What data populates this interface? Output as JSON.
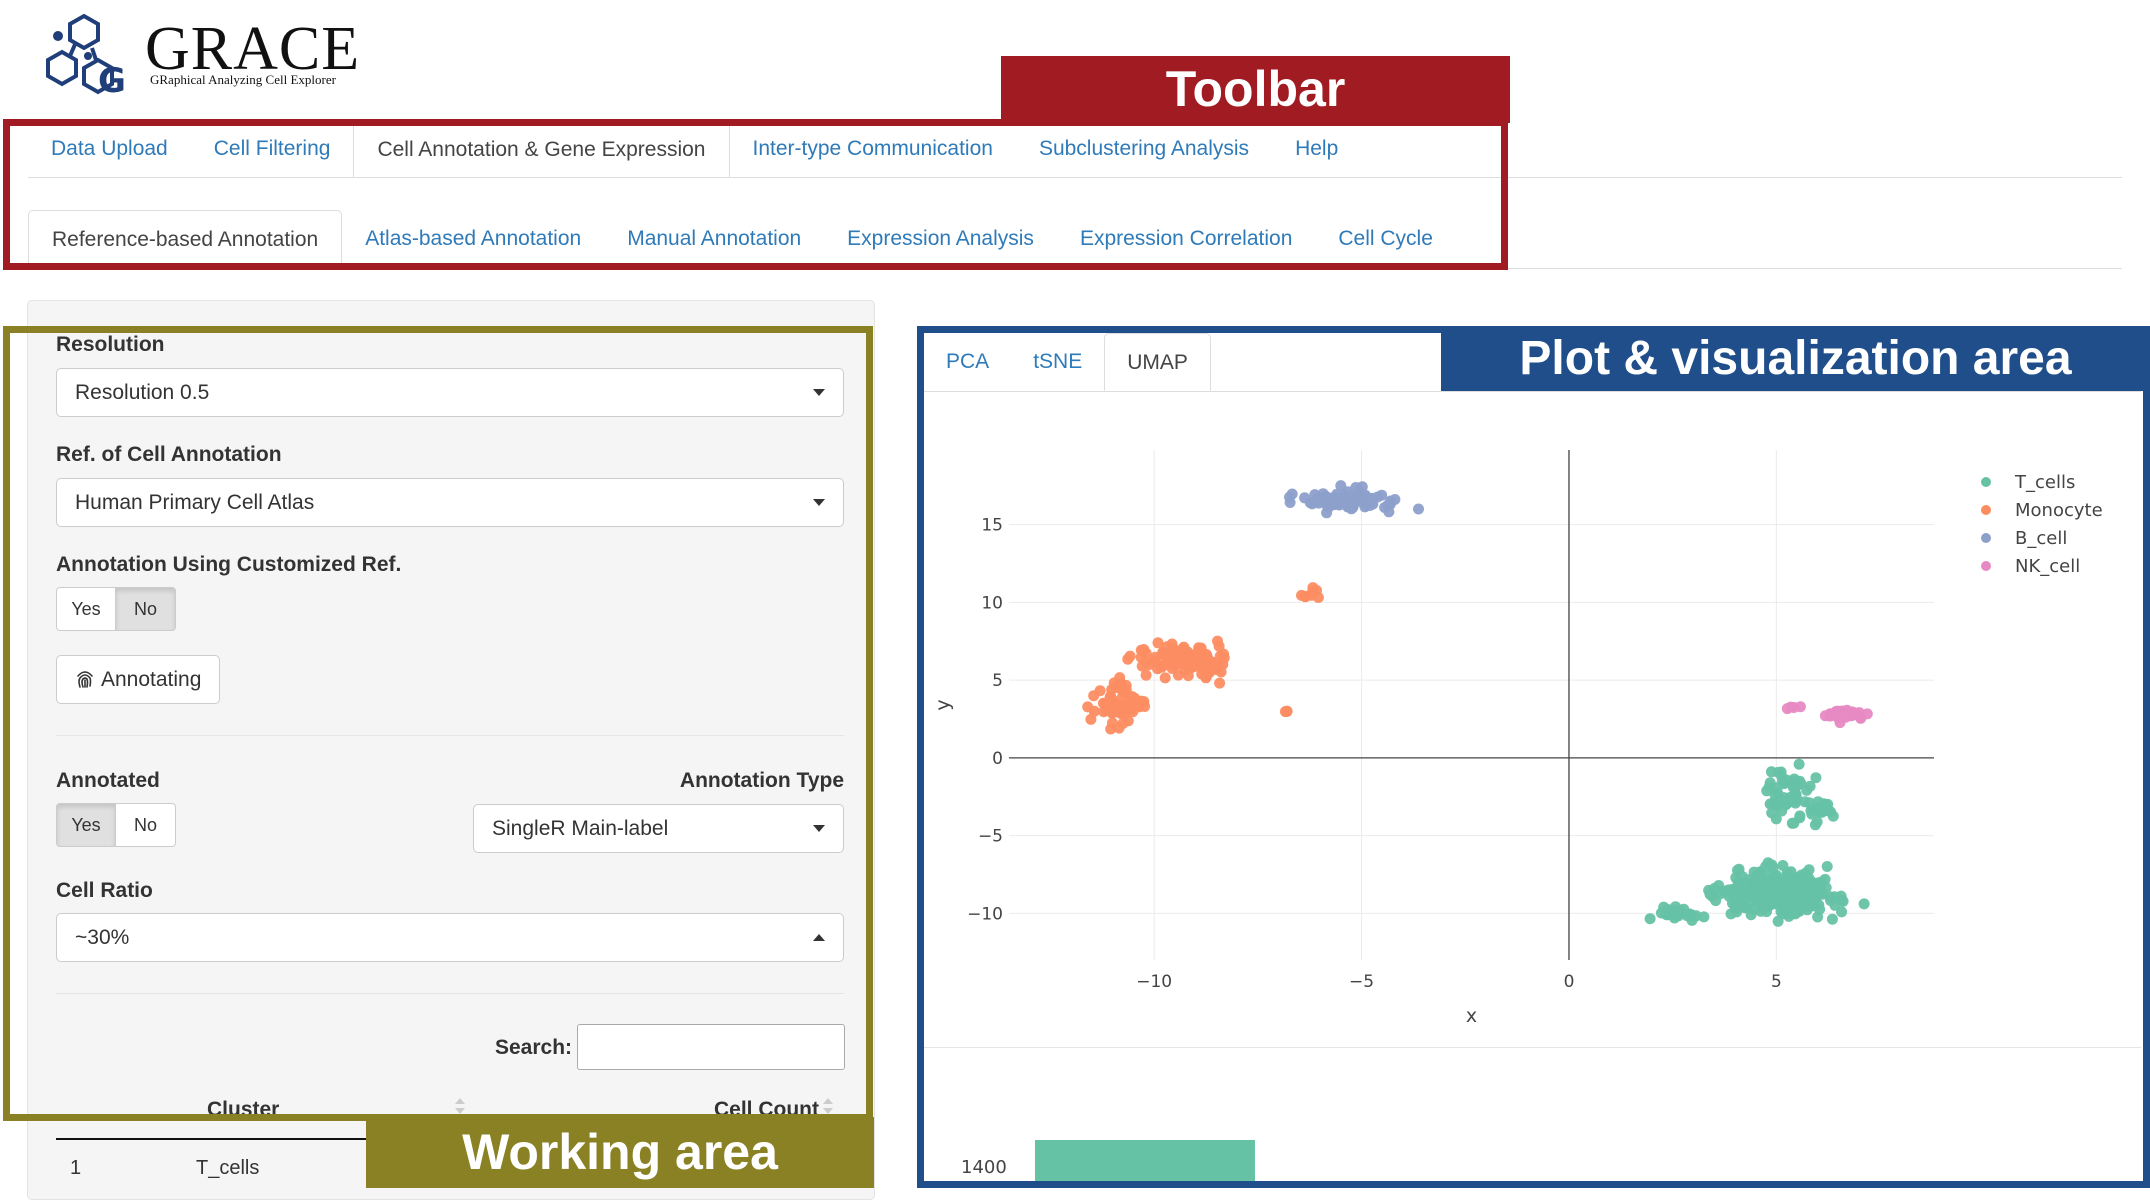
{
  "logo": {
    "title": "GRACE",
    "subtitle": "GRaphical Analyzing Cell Explorer"
  },
  "annotations": {
    "toolbar": "Toolbar",
    "working": "Working area",
    "plot": "Plot & visualization area"
  },
  "colors": {
    "toolbar": "#a01c22",
    "working": "#8a8124",
    "plot": "#1f4e8a",
    "link": "#2f7ab8"
  },
  "main_tabs": [
    {
      "label": "Data Upload",
      "active": false
    },
    {
      "label": "Cell Filtering",
      "active": false
    },
    {
      "label": "Cell Annotation & Gene Expression",
      "active": true
    },
    {
      "label": "Inter-type Communication",
      "active": false
    },
    {
      "label": "Subclustering Analysis",
      "active": false
    },
    {
      "label": "Help",
      "active": false
    }
  ],
  "sub_tabs": [
    {
      "label": "Reference-based Annotation",
      "active": true
    },
    {
      "label": "Atlas-based Annotation",
      "active": false
    },
    {
      "label": "Manual Annotation",
      "active": false
    },
    {
      "label": "Expression Analysis",
      "active": false
    },
    {
      "label": "Expression Correlation",
      "active": false
    },
    {
      "label": "Cell Cycle",
      "active": false
    }
  ],
  "working": {
    "resolution_label": "Resolution",
    "resolution_value": "Resolution 0.5",
    "ref_label": "Ref. of Cell Annotation",
    "ref_value": "Human Primary Cell Atlas",
    "custom_label": "Annotation Using Customized Ref.",
    "custom_yes": "Yes",
    "custom_no": "No",
    "custom_selected": "No",
    "annotate_button": "Annotating",
    "annotate_icon": "fingerprint-icon",
    "annotated_label": "Annotated",
    "annotated_yes": "Yes",
    "annotated_no": "No",
    "annotated_selected": "Yes",
    "annotation_type_label": "Annotation Type",
    "annotation_type_value": "SingleR Main-label",
    "ratio_label": "Cell Ratio",
    "ratio_value": "~30%",
    "search_label": "Search:",
    "search_value": "",
    "table": {
      "headers": [
        "Cluster",
        "Cell Count"
      ],
      "rows": [
        {
          "index": "1",
          "cluster": "T_cells"
        }
      ]
    }
  },
  "plot_tabs": [
    {
      "label": "PCA",
      "active": false
    },
    {
      "label": "tSNE",
      "active": false
    },
    {
      "label": "UMAP",
      "active": true
    }
  ],
  "chart_data": {
    "type": "scatter",
    "xlabel": "x",
    "ylabel": "y",
    "xlim": [
      -13.5,
      8.8
    ],
    "ylim": [
      -13,
      19.8
    ],
    "xticks": [
      -10,
      -5,
      0,
      5
    ],
    "xtick_labels": [
      "−10",
      "−5",
      "0",
      "5"
    ],
    "yticks": [
      -10,
      -5,
      0,
      5,
      10,
      15
    ],
    "ytick_labels": [
      "−10",
      "−5",
      "0",
      "5",
      "10",
      "15"
    ],
    "legend_position": "top-right",
    "series": [
      {
        "name": "T_cells",
        "color": "#66c2a5",
        "clusters": [
          {
            "cx": 5.0,
            "cy": -8.7,
            "sx": 1.3,
            "sy": 1.2,
            "n": 280
          },
          {
            "cx": 2.5,
            "cy": -10.0,
            "sx": 0.5,
            "sy": 0.3,
            "n": 25
          },
          {
            "cx": 5.4,
            "cy": -2.3,
            "sx": 0.5,
            "sy": 1.5,
            "n": 60
          },
          {
            "cx": 6.1,
            "cy": -3.2,
            "sx": 0.3,
            "sy": 0.4,
            "n": 15
          }
        ]
      },
      {
        "name": "Monocyte",
        "color": "#fc8d62",
        "clusters": [
          {
            "cx": -9.3,
            "cy": 6.3,
            "sx": 1.0,
            "sy": 0.8,
            "n": 120
          },
          {
            "cx": -10.8,
            "cy": 3.5,
            "sx": 0.5,
            "sy": 1.2,
            "n": 60
          },
          {
            "cx": -6.1,
            "cy": 10.6,
            "sx": 0.3,
            "sy": 0.3,
            "n": 8
          },
          {
            "cx": -6.8,
            "cy": 3.0,
            "sx": 0.05,
            "sy": 0.05,
            "n": 3
          }
        ]
      },
      {
        "name": "B_cell",
        "color": "#8da0cb",
        "clusters": [
          {
            "cx": -5.3,
            "cy": 16.5,
            "sx": 0.9,
            "sy": 0.6,
            "n": 90
          }
        ]
      },
      {
        "name": "NK_cell",
        "color": "#e78ac3",
        "clusters": [
          {
            "cx": 6.6,
            "cy": 2.8,
            "sx": 0.5,
            "sy": 0.3,
            "n": 35
          },
          {
            "cx": 5.5,
            "cy": 3.2,
            "sx": 0.2,
            "sy": 0.1,
            "n": 4
          }
        ]
      }
    ]
  },
  "second_plot": {
    "ytick_label": "1400",
    "bar_color": "#66c2a5"
  }
}
